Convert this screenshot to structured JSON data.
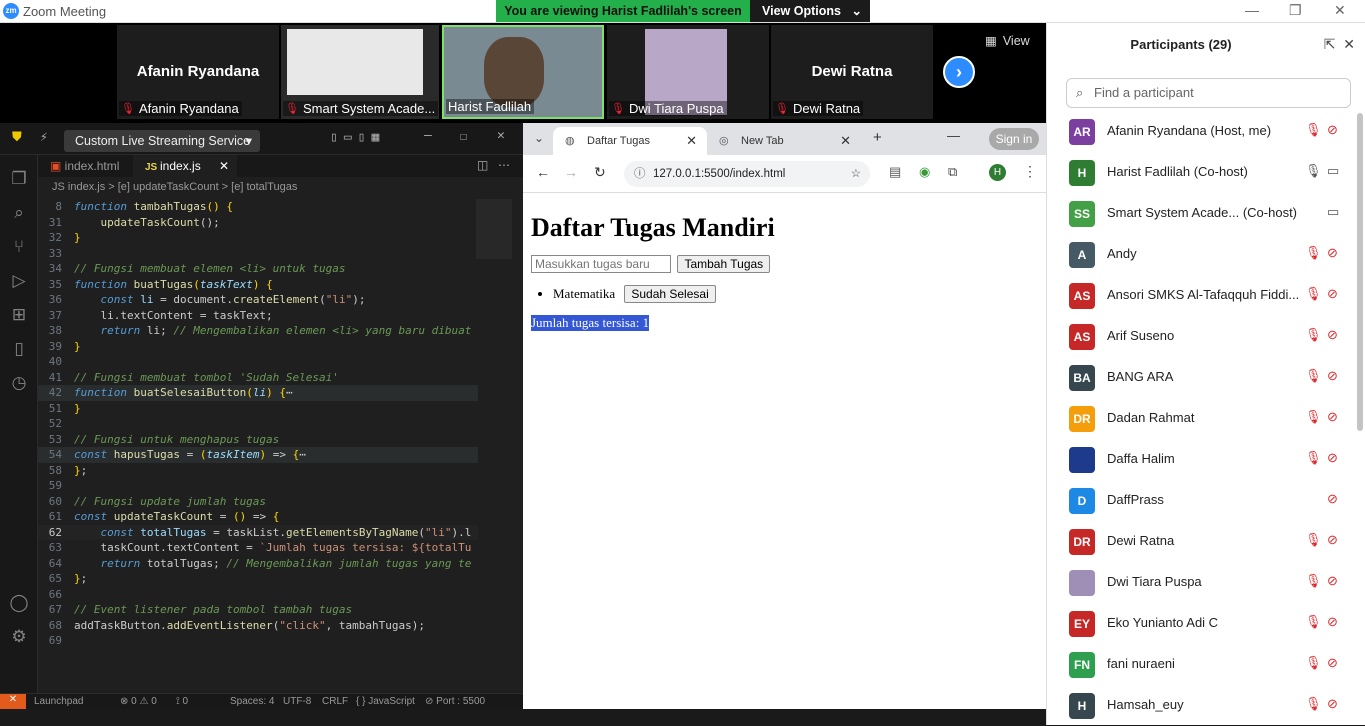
{
  "window": {
    "title": "Zoom Meeting",
    "logo": "zm"
  },
  "banner": {
    "message": "You are viewing Harist Fadlilah's screen",
    "view_options": "View Options"
  },
  "strip": {
    "tiles": [
      {
        "big": "Afanin Ryandana",
        "label": "Afanin Ryandana"
      },
      {
        "big": "",
        "label": "Smart System Acade..."
      },
      {
        "big": "",
        "label": "Harist Fadlilah"
      },
      {
        "big": "",
        "label": "Dwi Tiara Puspa"
      },
      {
        "big": "Dewi Ratna",
        "label": "Dewi Ratna"
      }
    ],
    "view": "View"
  },
  "vscode": {
    "stream_button": "Custom Live Streaming Service",
    "tabs": [
      "index.html",
      "index.js"
    ],
    "breadcrumb": "JS  index.js  >  [e] updateTaskCount  >  [e] totalTugas",
    "status": {
      "launchpad": "Launchpad",
      "errors": "⊗ 0 ⚠ 0",
      "ports": "⟟ 0",
      "spaces": "Spaces: 4",
      "enc": "UTF-8",
      "eol": "CRLF",
      "lang": "{ } JavaScript",
      "port": "⊘ Port : 5500"
    }
  },
  "browser": {
    "tabs": [
      "Daftar Tugas",
      "New Tab"
    ],
    "url": "127.0.0.1:5500/index.html",
    "sign_in": "Sign in",
    "page": {
      "h1": "Daftar Tugas Mandiri",
      "placeholder": "Masukkan tugas baru",
      "add_btn": "Tambah Tugas",
      "item": "Matematika",
      "done_btn": "Sudah Selesai",
      "count": "Jumlah tugas tersisa: 1"
    }
  },
  "participants": {
    "title": "Participants (29)",
    "search": "Find a participant",
    "list": [
      {
        "initials": "AR",
        "color": "#7b3fa0",
        "name": "Afanin Ryandana (Host, me)",
        "mic": "off",
        "video": "off"
      },
      {
        "initials": "H",
        "color": "#2e7d32",
        "name": "Harist Fadlilah (Co-host)",
        "mic": "on",
        "video": "on"
      },
      {
        "initials": "SS",
        "color": "#43a047",
        "name": "Smart System Acade...  (Co-host)",
        "mic": "",
        "video": "on"
      },
      {
        "initials": "A",
        "color": "#455a64",
        "name": "Andy",
        "mic": "off",
        "video": "off"
      },
      {
        "initials": "AS",
        "color": "#c62828",
        "name": "Ansori SMKS Al-Tafaqquh Fiddi...",
        "mic": "off",
        "video": "off"
      },
      {
        "initials": "AS",
        "color": "#c62828",
        "name": "Arif Suseno",
        "mic": "off",
        "video": "off"
      },
      {
        "initials": "BA",
        "color": "#37474f",
        "name": "BANG ARA",
        "mic": "off",
        "video": "off"
      },
      {
        "initials": "DR",
        "color": "#f59e0b",
        "name": "Dadan Rahmat",
        "mic": "off",
        "video": "off"
      },
      {
        "initials": "",
        "color": "#1e3a8a",
        "name": "Daffa Halim",
        "mic": "off",
        "video": "off"
      },
      {
        "initials": "D",
        "color": "#1e88e5",
        "name": "DaffPrass",
        "mic": "",
        "video": "off"
      },
      {
        "initials": "DR",
        "color": "#c62828",
        "name": "Dewi Ratna",
        "mic": "off",
        "video": "off"
      },
      {
        "initials": "",
        "color": "#9f8fb7",
        "name": "Dwi Tiara Puspa",
        "mic": "off",
        "video": "off"
      },
      {
        "initials": "EY",
        "color": "#c62828",
        "name": "Eko Yunianto Adi C",
        "mic": "off",
        "video": "off"
      },
      {
        "initials": "FN",
        "color": "#2e9e4f",
        "name": "fani nuraeni",
        "mic": "off",
        "video": "off"
      },
      {
        "initials": "H",
        "color": "#37474f",
        "name": "Hamsah_euy",
        "mic": "off",
        "video": "off"
      }
    ]
  }
}
